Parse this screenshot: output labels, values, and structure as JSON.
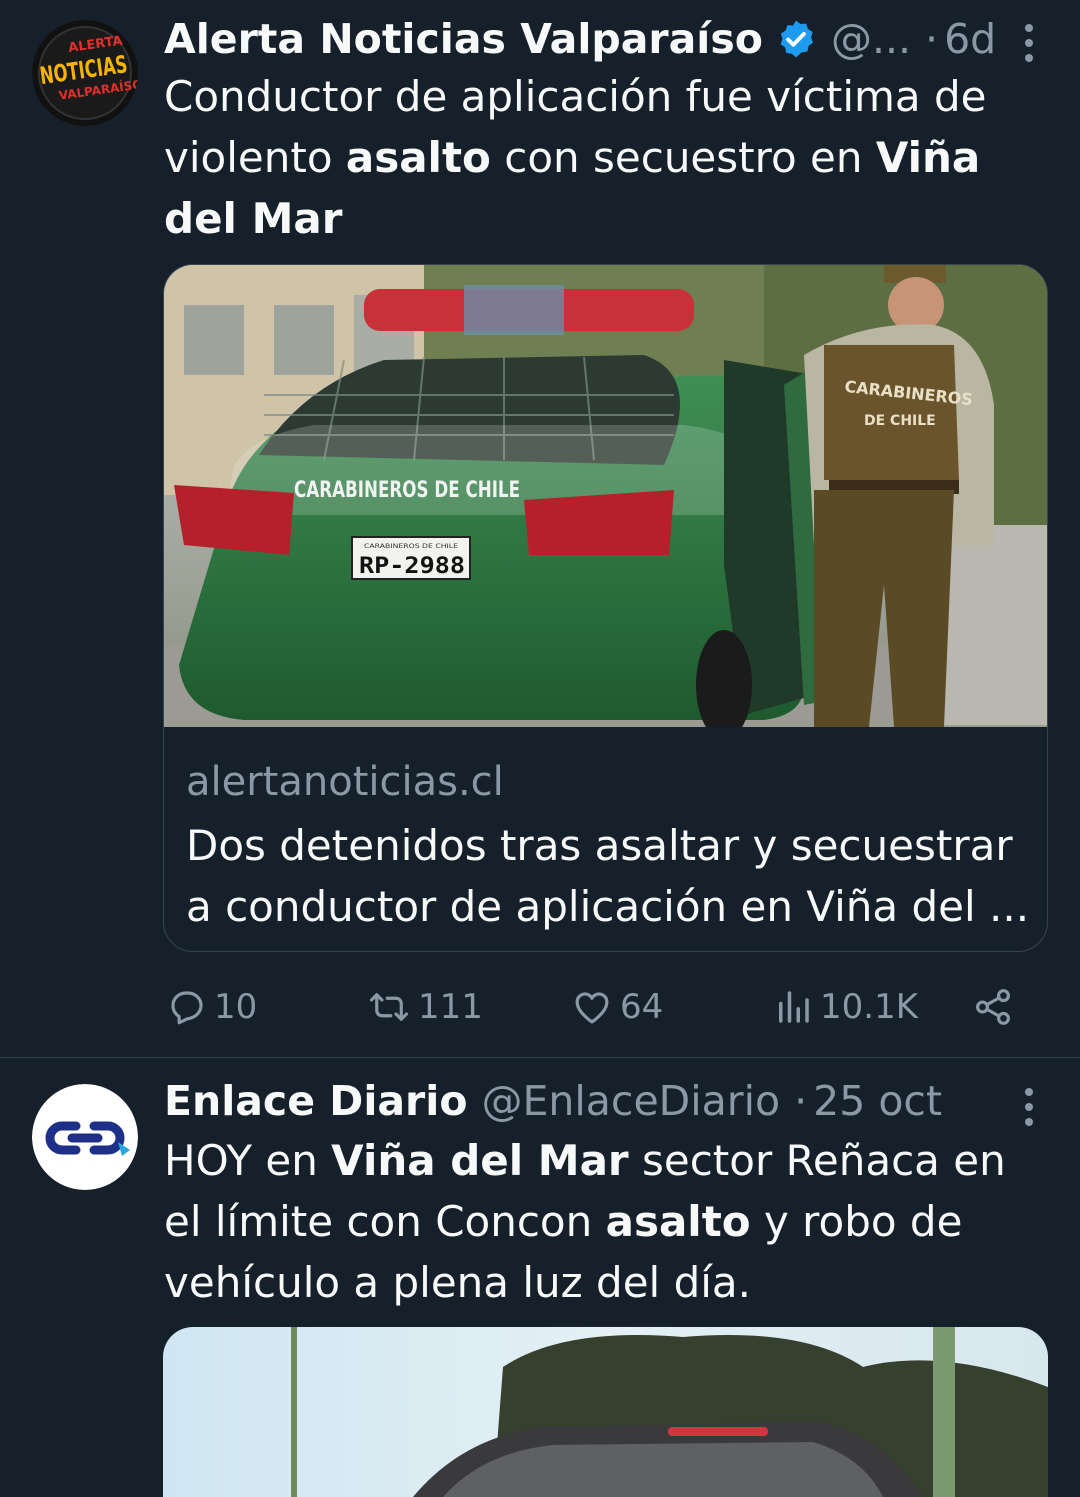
{
  "tweets": [
    {
      "author_name": "Alerta Noticias Valparaíso",
      "handle": "@...",
      "separator": "·",
      "time": "6d",
      "avatar_text": [
        "ALERTA",
        "NOTICIAS",
        "VALPARAÍSO"
      ],
      "text_parts": [
        "Conductor de aplicación fue víctima de violento ",
        "asalto",
        " con secuestro en ",
        "Viña del Mar"
      ],
      "card": {
        "image_texts": {
          "car_label": "CARABINEROS DE CHILE",
          "plate_top": "CARABINEROS DE CHILE",
          "plate": "RP-2988",
          "vest_line1": "CARABINEROS",
          "vest_line2": "DE CHILE"
        },
        "domain": "alertanoticias.cl",
        "title": "Dos detenidos tras asaltar y secuestrar a conductor de aplicación en Viña del ..."
      },
      "actions": {
        "replies": "10",
        "reposts": "111",
        "likes": "64",
        "views": "10.1K"
      }
    },
    {
      "author_name": "Enlace Diario",
      "handle": "@EnlaceDiario",
      "separator": "·",
      "time": "25 oct",
      "text_parts": [
        "HOY en ",
        "Viña del Mar",
        " sector Reñaca en el límite con Concon ",
        "asalto",
        " y robo de vehículo a plena luz del día."
      ]
    }
  ],
  "icons": [
    "verified-badge-icon",
    "more-icon",
    "reply-icon",
    "repost-icon",
    "like-icon",
    "views-icon",
    "share-icon"
  ],
  "colors": {
    "background": "#15202b",
    "text": "#f7f9f9",
    "secondary": "#8b98a5",
    "border": "#38444d",
    "verified": "#1d9bf0"
  }
}
